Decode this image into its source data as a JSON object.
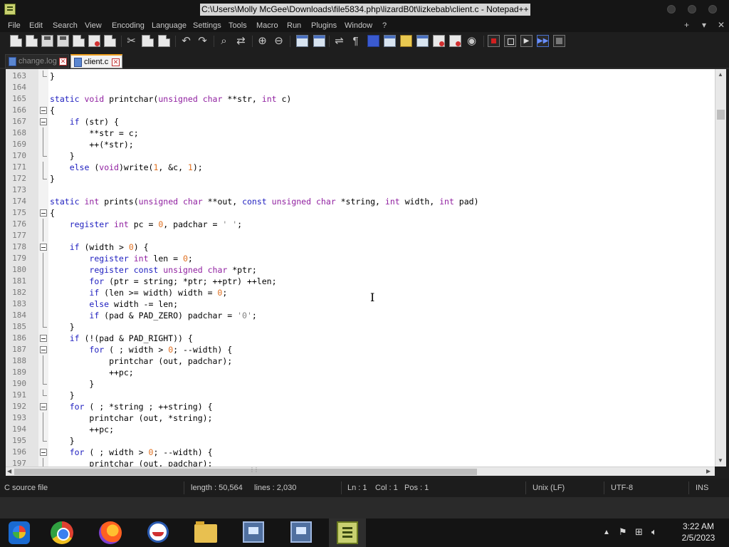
{
  "window": {
    "title": "C:\\Users\\Molly McGee\\Downloads\\file5834.php\\lizardB0t\\lizkebab\\client.c - Notepad++"
  },
  "menu": {
    "items": [
      "File",
      "Edit",
      "Search",
      "View",
      "Encoding",
      "Language",
      "Settings",
      "Tools",
      "Macro",
      "Run",
      "Plugins",
      "Window",
      "?"
    ],
    "right_plus": "+",
    "right_arrow": "▾",
    "right_close": "✕"
  },
  "tabs": [
    {
      "label": "change.log",
      "active": false
    },
    {
      "label": "client.c",
      "active": true
    }
  ],
  "editor": {
    "lines": [
      {
        "n": "163",
        "fold": "end",
        "t": "}"
      },
      {
        "n": "164",
        "fold": "",
        "t": ""
      },
      {
        "n": "165",
        "fold": "",
        "t": "static void printchar(unsigned char **str, int c)"
      },
      {
        "n": "166",
        "fold": "box",
        "t": "{"
      },
      {
        "n": "167",
        "fold": "box",
        "t": "    if (str) {"
      },
      {
        "n": "168",
        "fold": "line",
        "t": "        **str = c;"
      },
      {
        "n": "169",
        "fold": "line",
        "t": "        ++(*str);"
      },
      {
        "n": "170",
        "fold": "end",
        "t": "    }"
      },
      {
        "n": "171",
        "fold": "line",
        "t": "    else (void)write(1, &c, 1);"
      },
      {
        "n": "172",
        "fold": "end",
        "t": "}"
      },
      {
        "n": "173",
        "fold": "",
        "t": ""
      },
      {
        "n": "174",
        "fold": "",
        "t": "static int prints(unsigned char **out, const unsigned char *string, int width, int pad)"
      },
      {
        "n": "175",
        "fold": "box",
        "t": "{"
      },
      {
        "n": "176",
        "fold": "line",
        "t": "    register int pc = 0, padchar = ' ';"
      },
      {
        "n": "177",
        "fold": "line",
        "t": ""
      },
      {
        "n": "178",
        "fold": "box",
        "t": "    if (width > 0) {"
      },
      {
        "n": "179",
        "fold": "line",
        "t": "        register int len = 0;"
      },
      {
        "n": "180",
        "fold": "line",
        "t": "        register const unsigned char *ptr;"
      },
      {
        "n": "181",
        "fold": "line",
        "t": "        for (ptr = string; *ptr; ++ptr) ++len;"
      },
      {
        "n": "182",
        "fold": "line",
        "t": "        if (len >= width) width = 0;"
      },
      {
        "n": "183",
        "fold": "line",
        "t": "        else width -= len;"
      },
      {
        "n": "184",
        "fold": "line",
        "t": "        if (pad & PAD_ZERO) padchar = '0';"
      },
      {
        "n": "185",
        "fold": "end",
        "t": "    }"
      },
      {
        "n": "186",
        "fold": "box",
        "t": "    if (!(pad & PAD_RIGHT)) {"
      },
      {
        "n": "187",
        "fold": "box",
        "t": "        for ( ; width > 0; --width) {"
      },
      {
        "n": "188",
        "fold": "line",
        "t": "            printchar (out, padchar);"
      },
      {
        "n": "189",
        "fold": "line",
        "t": "            ++pc;"
      },
      {
        "n": "190",
        "fold": "end",
        "t": "        }"
      },
      {
        "n": "191",
        "fold": "end",
        "t": "    }"
      },
      {
        "n": "192",
        "fold": "box",
        "t": "    for ( ; *string ; ++string) {"
      },
      {
        "n": "193",
        "fold": "line",
        "t": "        printchar (out, *string);"
      },
      {
        "n": "194",
        "fold": "line",
        "t": "        ++pc;"
      },
      {
        "n": "195",
        "fold": "end",
        "t": "    }"
      },
      {
        "n": "196",
        "fold": "box",
        "t": "    for ( ; width > 0; --width) {"
      },
      {
        "n": "197",
        "fold": "line",
        "t": "        printchar (out, padchar);"
      }
    ]
  },
  "statusbar": {
    "filetype": "C source file",
    "length": "length : 50,564",
    "lines": "lines : 2,030",
    "ln": "Ln : 1",
    "col": "Col : 1",
    "pos": "Pos : 1",
    "eol": "Unix (LF)",
    "encoding": "UTF-8",
    "mode": "INS"
  },
  "taskbar": {
    "time": "3:22 AM",
    "date": "2/5/2023"
  }
}
